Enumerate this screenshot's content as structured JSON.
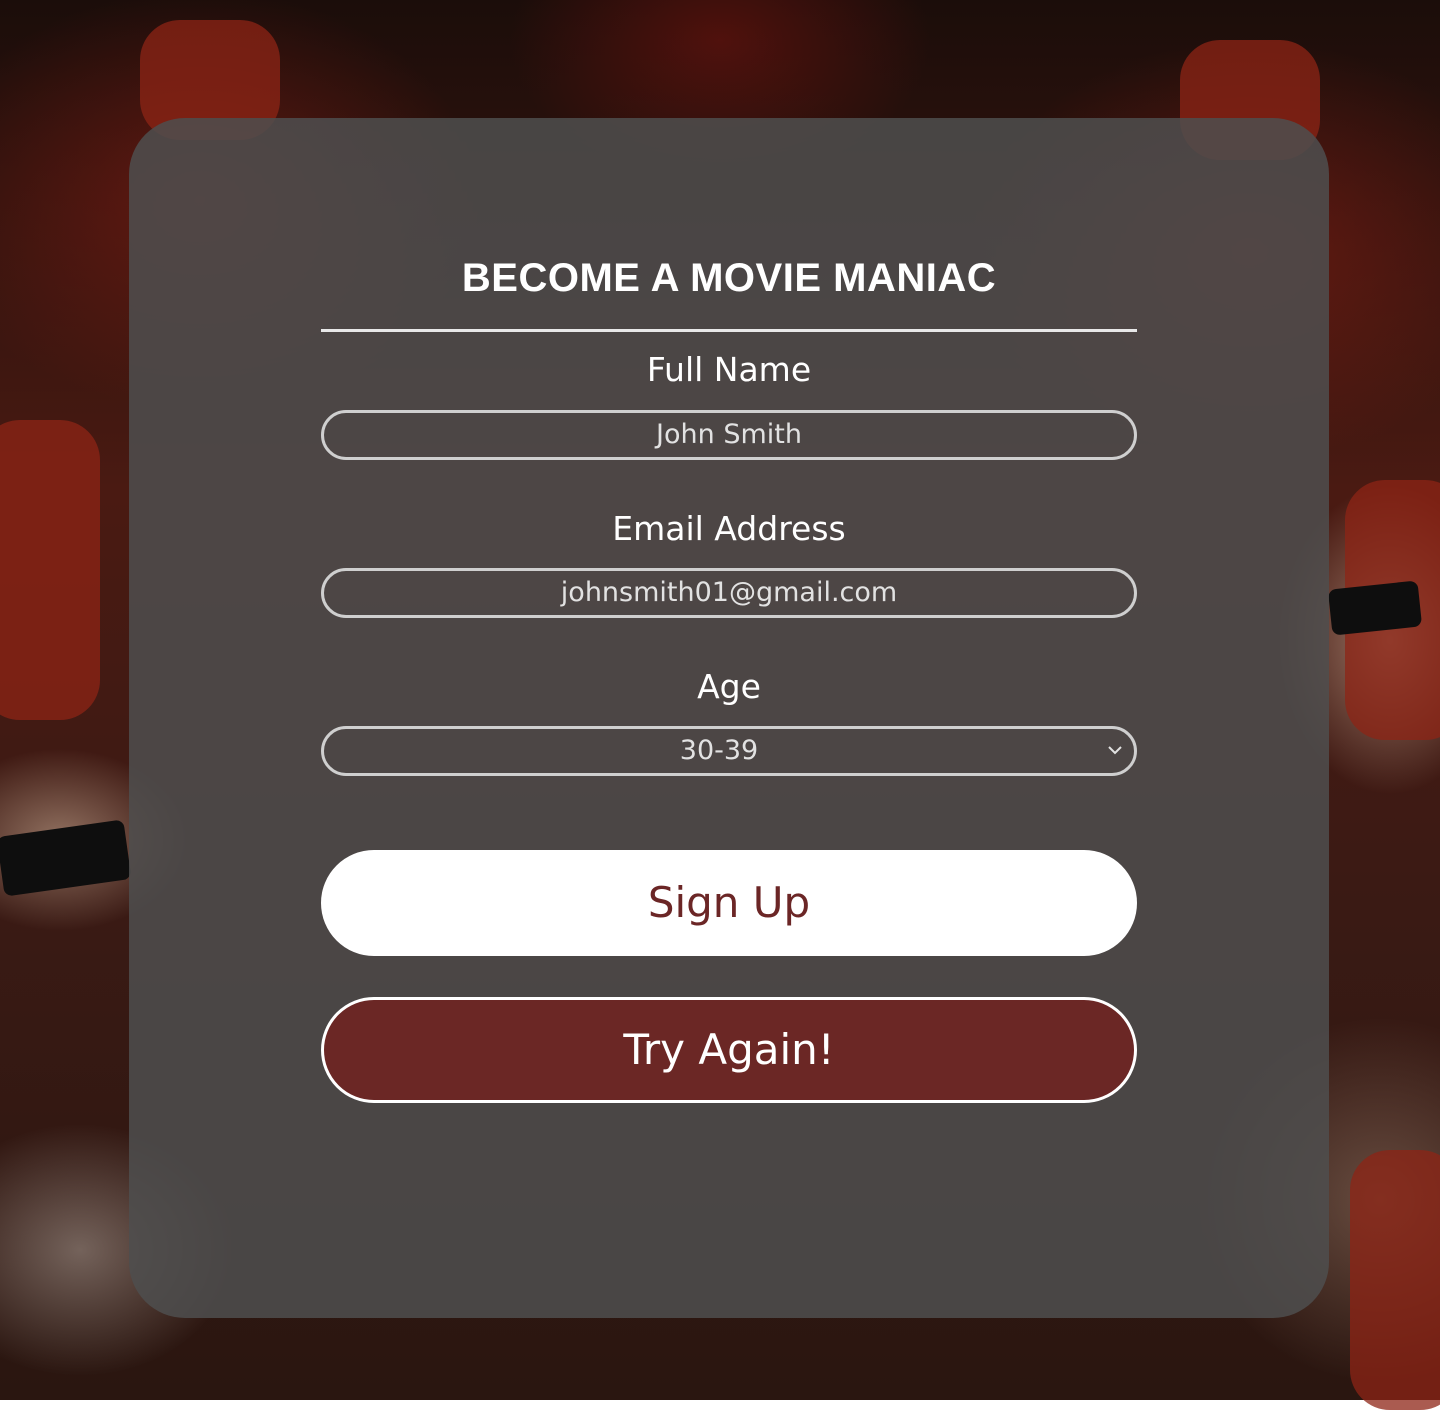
{
  "form": {
    "title": "BECOME A MOVIE MANIAC",
    "full_name": {
      "label": "Full Name",
      "value": "John Smith"
    },
    "email": {
      "label": "Email Address",
      "value": "johnsmith01@gmail.com"
    },
    "age": {
      "label": "Age",
      "selected": "30-39"
    },
    "sign_up_label": "Sign Up",
    "try_again_label": "Try Again!"
  },
  "icons": {
    "age_select": "chevron-down-icon"
  },
  "colors": {
    "card_background": "#4e4e4e",
    "field_border": "#cfcfcf",
    "sign_up_background": "#ffffff",
    "sign_up_text": "#6b2626",
    "try_again_background": "#6b2725",
    "try_again_text": "#ffffff"
  }
}
